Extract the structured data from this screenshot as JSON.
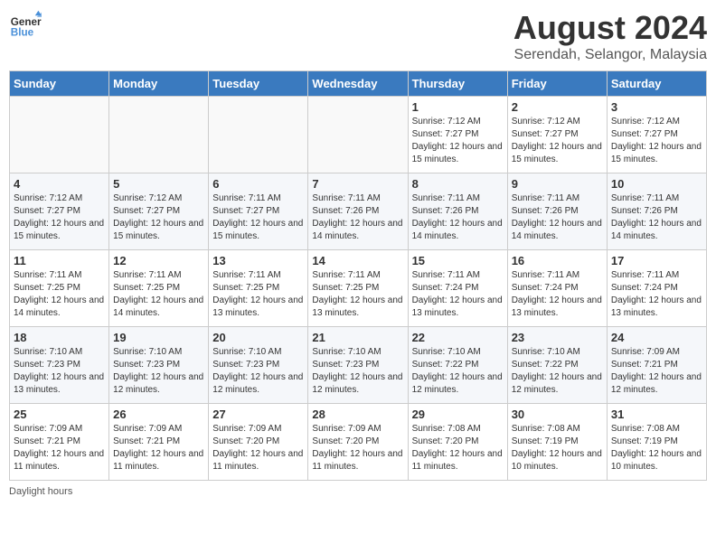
{
  "header": {
    "logo_line1": "General",
    "logo_line2": "Blue",
    "month": "August 2024",
    "location": "Serendah, Selangor, Malaysia"
  },
  "weekdays": [
    "Sunday",
    "Monday",
    "Tuesday",
    "Wednesday",
    "Thursday",
    "Friday",
    "Saturday"
  ],
  "weeks": [
    [
      {
        "day": "",
        "info": ""
      },
      {
        "day": "",
        "info": ""
      },
      {
        "day": "",
        "info": ""
      },
      {
        "day": "",
        "info": ""
      },
      {
        "day": "1",
        "info": "Sunrise: 7:12 AM\nSunset: 7:27 PM\nDaylight: 12 hours and 15 minutes."
      },
      {
        "day": "2",
        "info": "Sunrise: 7:12 AM\nSunset: 7:27 PM\nDaylight: 12 hours and 15 minutes."
      },
      {
        "day": "3",
        "info": "Sunrise: 7:12 AM\nSunset: 7:27 PM\nDaylight: 12 hours and 15 minutes."
      }
    ],
    [
      {
        "day": "4",
        "info": "Sunrise: 7:12 AM\nSunset: 7:27 PM\nDaylight: 12 hours and 15 minutes."
      },
      {
        "day": "5",
        "info": "Sunrise: 7:12 AM\nSunset: 7:27 PM\nDaylight: 12 hours and 15 minutes."
      },
      {
        "day": "6",
        "info": "Sunrise: 7:11 AM\nSunset: 7:27 PM\nDaylight: 12 hours and 15 minutes."
      },
      {
        "day": "7",
        "info": "Sunrise: 7:11 AM\nSunset: 7:26 PM\nDaylight: 12 hours and 14 minutes."
      },
      {
        "day": "8",
        "info": "Sunrise: 7:11 AM\nSunset: 7:26 PM\nDaylight: 12 hours and 14 minutes."
      },
      {
        "day": "9",
        "info": "Sunrise: 7:11 AM\nSunset: 7:26 PM\nDaylight: 12 hours and 14 minutes."
      },
      {
        "day": "10",
        "info": "Sunrise: 7:11 AM\nSunset: 7:26 PM\nDaylight: 12 hours and 14 minutes."
      }
    ],
    [
      {
        "day": "11",
        "info": "Sunrise: 7:11 AM\nSunset: 7:25 PM\nDaylight: 12 hours and 14 minutes."
      },
      {
        "day": "12",
        "info": "Sunrise: 7:11 AM\nSunset: 7:25 PM\nDaylight: 12 hours and 14 minutes."
      },
      {
        "day": "13",
        "info": "Sunrise: 7:11 AM\nSunset: 7:25 PM\nDaylight: 12 hours and 13 minutes."
      },
      {
        "day": "14",
        "info": "Sunrise: 7:11 AM\nSunset: 7:25 PM\nDaylight: 12 hours and 13 minutes."
      },
      {
        "day": "15",
        "info": "Sunrise: 7:11 AM\nSunset: 7:24 PM\nDaylight: 12 hours and 13 minutes."
      },
      {
        "day": "16",
        "info": "Sunrise: 7:11 AM\nSunset: 7:24 PM\nDaylight: 12 hours and 13 minutes."
      },
      {
        "day": "17",
        "info": "Sunrise: 7:11 AM\nSunset: 7:24 PM\nDaylight: 12 hours and 13 minutes."
      }
    ],
    [
      {
        "day": "18",
        "info": "Sunrise: 7:10 AM\nSunset: 7:23 PM\nDaylight: 12 hours and 13 minutes."
      },
      {
        "day": "19",
        "info": "Sunrise: 7:10 AM\nSunset: 7:23 PM\nDaylight: 12 hours and 12 minutes."
      },
      {
        "day": "20",
        "info": "Sunrise: 7:10 AM\nSunset: 7:23 PM\nDaylight: 12 hours and 12 minutes."
      },
      {
        "day": "21",
        "info": "Sunrise: 7:10 AM\nSunset: 7:23 PM\nDaylight: 12 hours and 12 minutes."
      },
      {
        "day": "22",
        "info": "Sunrise: 7:10 AM\nSunset: 7:22 PM\nDaylight: 12 hours and 12 minutes."
      },
      {
        "day": "23",
        "info": "Sunrise: 7:10 AM\nSunset: 7:22 PM\nDaylight: 12 hours and 12 minutes."
      },
      {
        "day": "24",
        "info": "Sunrise: 7:09 AM\nSunset: 7:21 PM\nDaylight: 12 hours and 12 minutes."
      }
    ],
    [
      {
        "day": "25",
        "info": "Sunrise: 7:09 AM\nSunset: 7:21 PM\nDaylight: 12 hours and 11 minutes."
      },
      {
        "day": "26",
        "info": "Sunrise: 7:09 AM\nSunset: 7:21 PM\nDaylight: 12 hours and 11 minutes."
      },
      {
        "day": "27",
        "info": "Sunrise: 7:09 AM\nSunset: 7:20 PM\nDaylight: 12 hours and 11 minutes."
      },
      {
        "day": "28",
        "info": "Sunrise: 7:09 AM\nSunset: 7:20 PM\nDaylight: 12 hours and 11 minutes."
      },
      {
        "day": "29",
        "info": "Sunrise: 7:08 AM\nSunset: 7:20 PM\nDaylight: 12 hours and 11 minutes."
      },
      {
        "day": "30",
        "info": "Sunrise: 7:08 AM\nSunset: 7:19 PM\nDaylight: 12 hours and 10 minutes."
      },
      {
        "day": "31",
        "info": "Sunrise: 7:08 AM\nSunset: 7:19 PM\nDaylight: 12 hours and 10 minutes."
      }
    ]
  ],
  "footer": "Daylight hours"
}
